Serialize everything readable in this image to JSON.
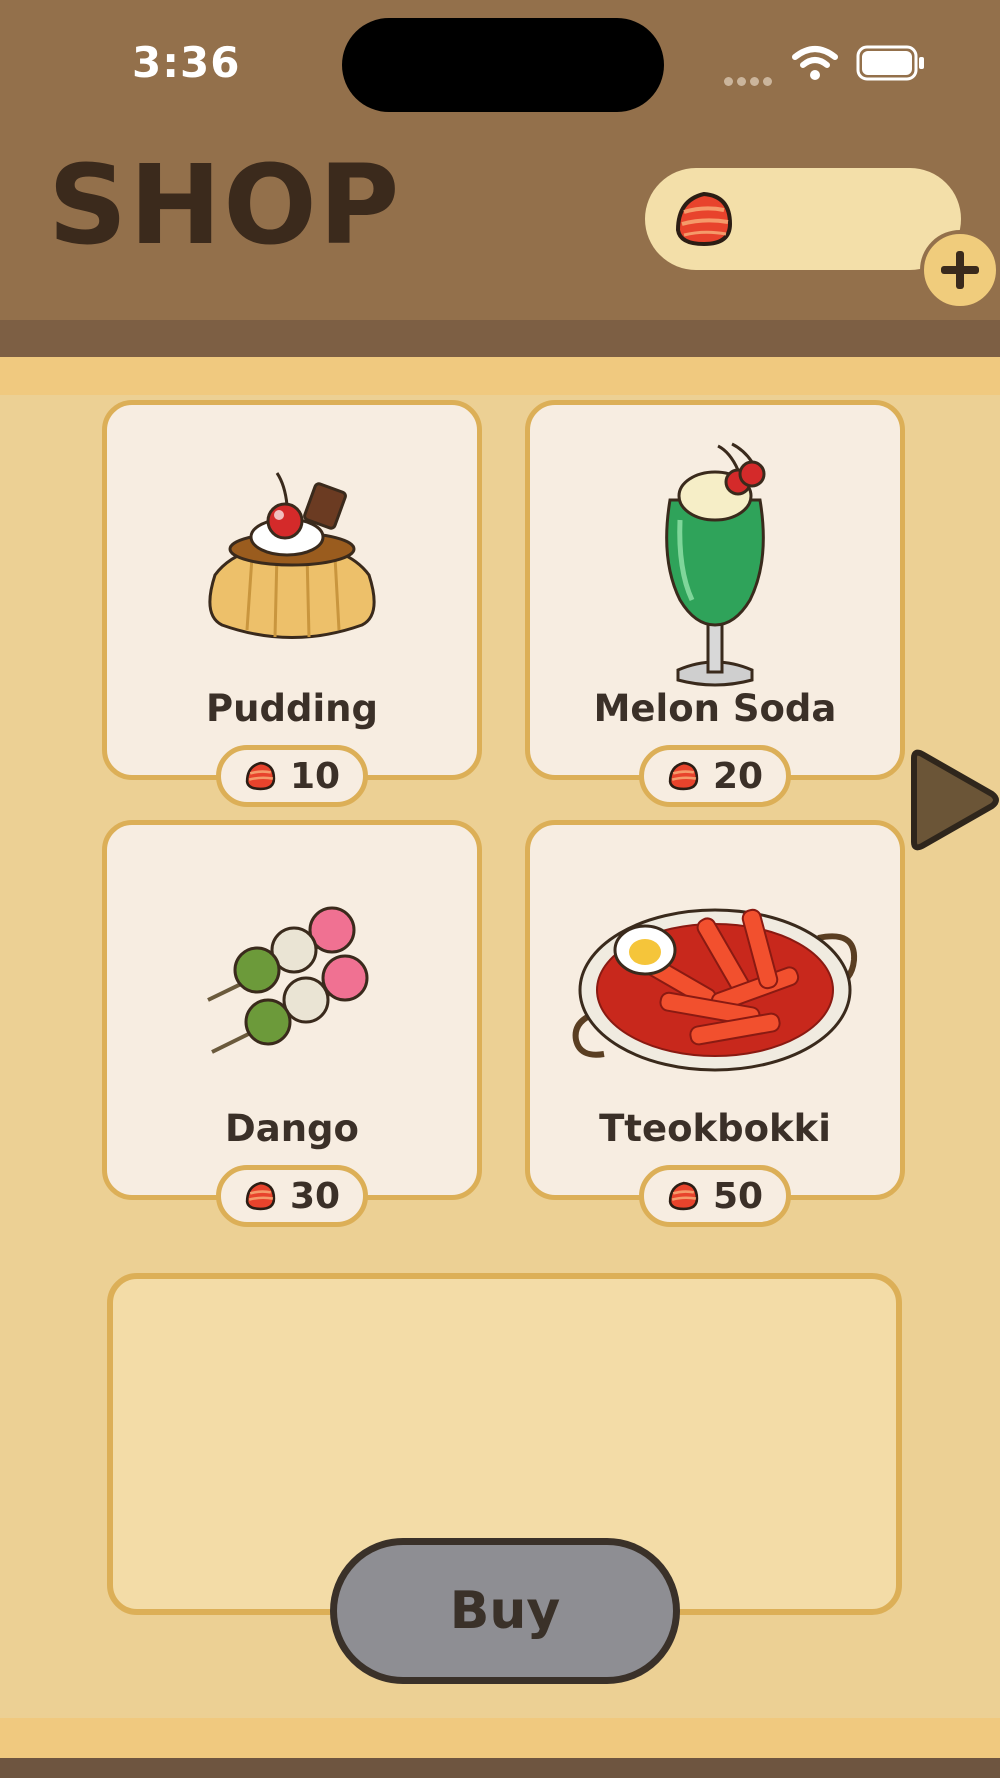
{
  "status_bar": {
    "time": "3:36"
  },
  "header": {
    "title": "SHOP",
    "currency_value": ""
  },
  "items": [
    {
      "name": "Pudding",
      "price": "10"
    },
    {
      "name": "Melon Soda",
      "price": "20"
    },
    {
      "name": "Dango",
      "price": "30"
    },
    {
      "name": "Tteokbokki",
      "price": "50"
    }
  ],
  "buy_button": {
    "label": "Buy",
    "state": "disabled"
  },
  "icons": {
    "currency": "gem-icon",
    "add": "plus-icon",
    "next_page": "right-arrow-icon"
  },
  "colors": {
    "header_bg": "#93704b",
    "page_bg": "#ecd094",
    "card_bg": "#f7ede1",
    "card_border": "#dcaf57",
    "buy_button_bg": "#8e8e93",
    "title_text": "#3b2a1c"
  }
}
